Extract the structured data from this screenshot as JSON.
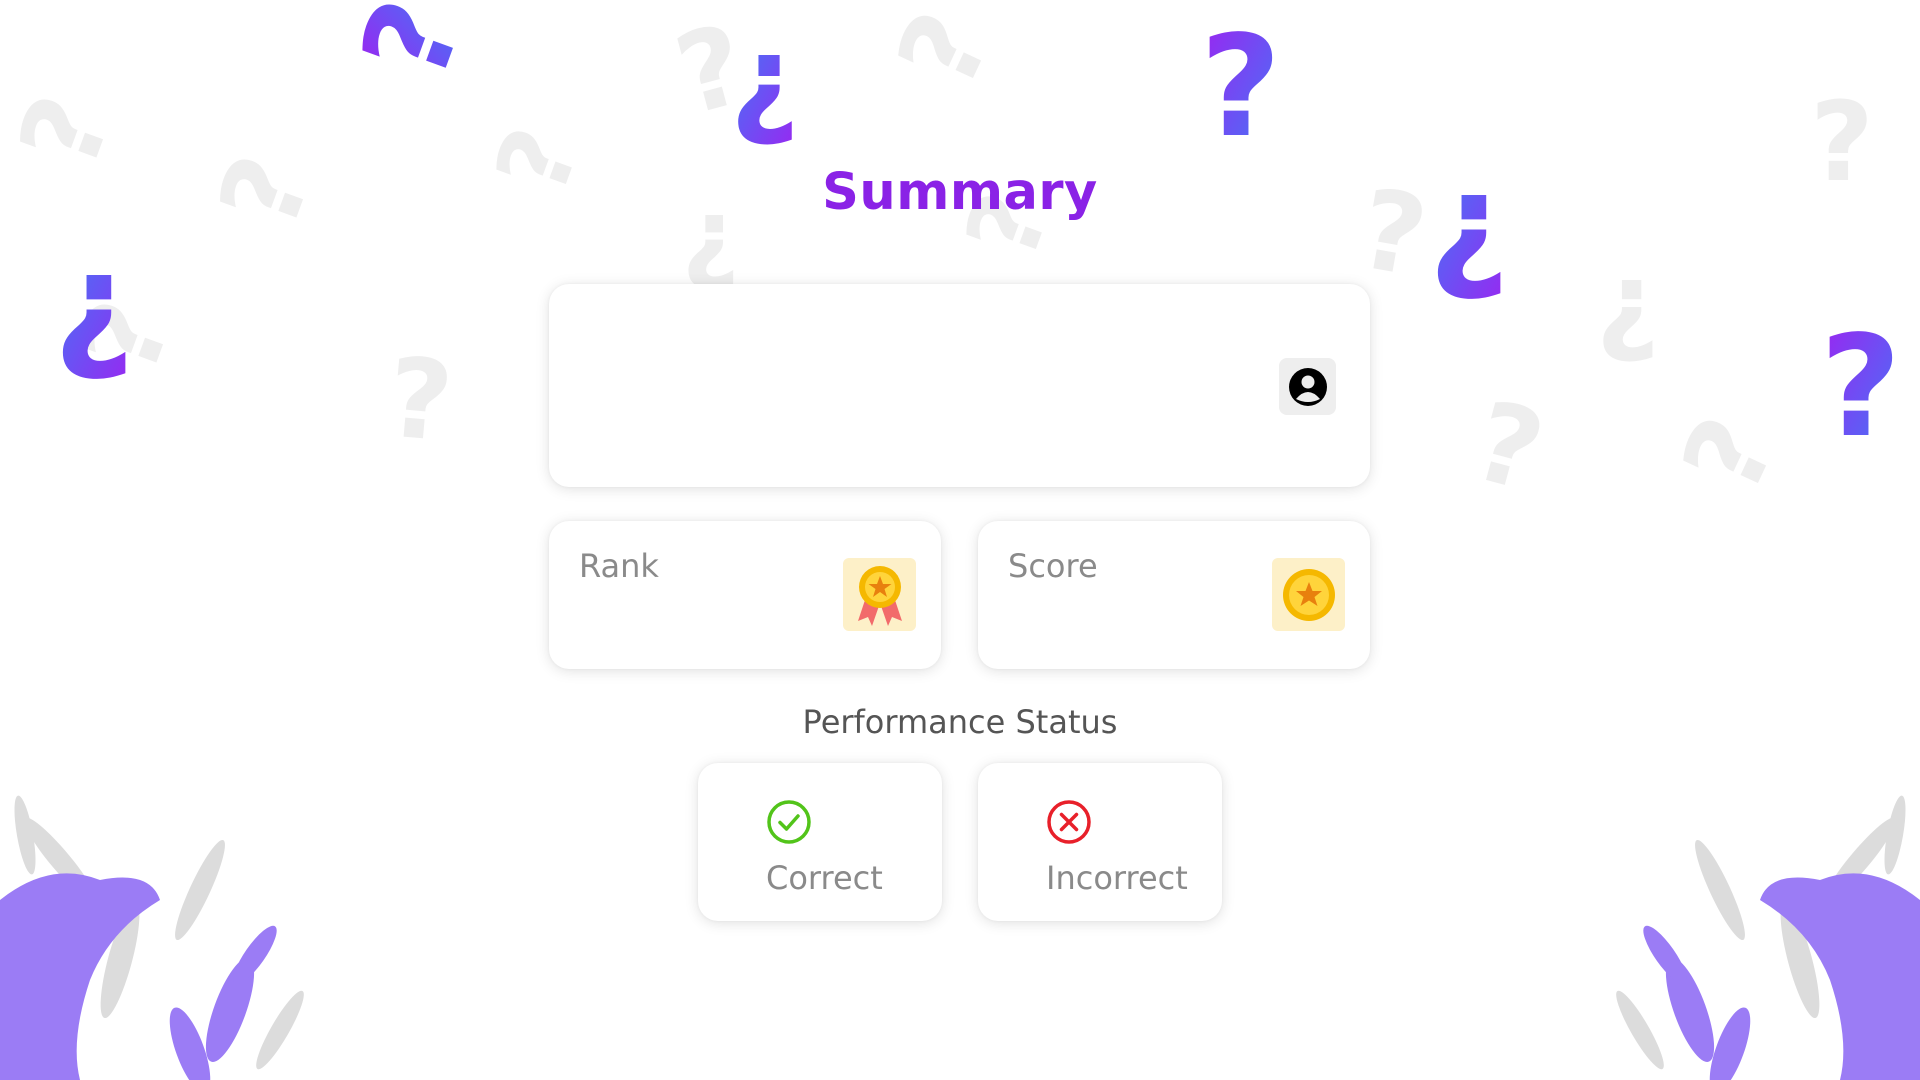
{
  "page": {
    "title": "Summary"
  },
  "profile": {
    "avatar_icon": "user-circle-icon"
  },
  "stats": {
    "rank": {
      "label": "Rank",
      "icon": "medal-icon"
    },
    "score": {
      "label": "Score",
      "icon": "coin-icon"
    }
  },
  "performance": {
    "title": "Performance Status",
    "correct": {
      "label": "Correct",
      "icon": "check-circle-icon",
      "color": "#52c41a"
    },
    "incorrect": {
      "label": "Incorrect",
      "icon": "x-circle-icon",
      "color": "#e8202a"
    }
  },
  "theme": {
    "accent_purple": "#8a22e6",
    "accent_blue": "#4a6cf7",
    "decoration_purple": "#9b7cf5",
    "decoration_gray": "#dddddd"
  }
}
